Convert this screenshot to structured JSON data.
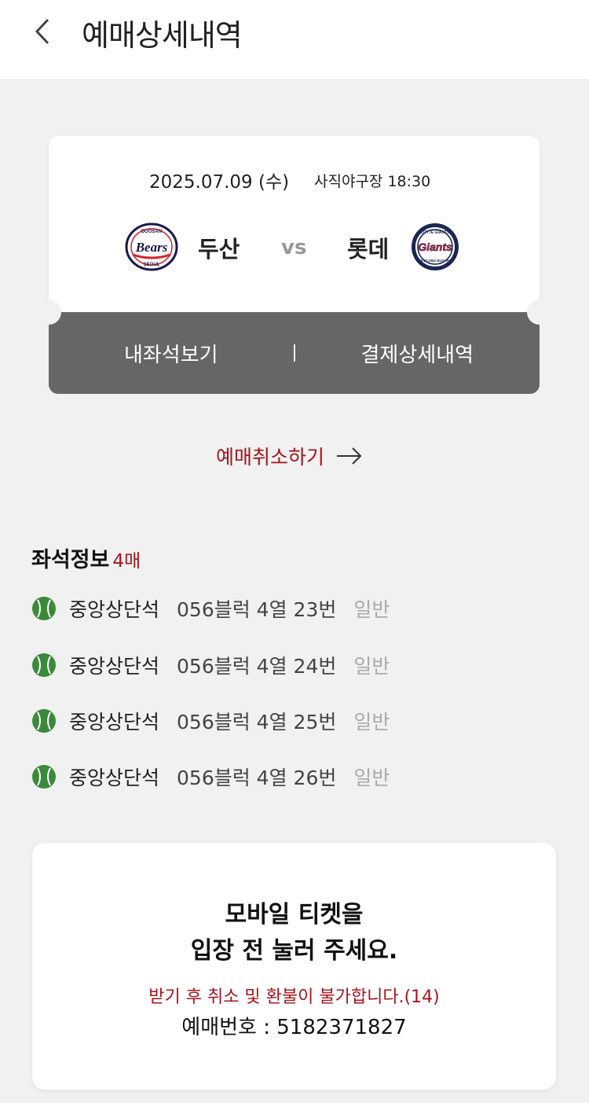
{
  "header": {
    "title": "예매상세내역",
    "back_icon": "chevron-left-icon"
  },
  "ticket": {
    "date": "2025.07.09 (수)",
    "venue_time": "사직야구장 18:30",
    "away_team": {
      "name": "두산",
      "logo_text": "Bears",
      "logo_top": "DOOSAN",
      "logo_bottom": "SEOUL",
      "color": "#1a1748"
    },
    "vs": "vs",
    "home_team": {
      "name": "롯데",
      "logo_text": "Giants",
      "logo_top": "LOTTE GIANTS",
      "logo_bottom": "EST.1982 BUSAN",
      "color": "#d41f2c"
    },
    "my_seat_link": "내좌석보기",
    "divider": "|",
    "payment_link": "결제상세내역"
  },
  "cancel": {
    "label": "예매취소하기",
    "arrow_icon": "arrow-right-icon"
  },
  "seats": {
    "title": "좌석정보",
    "count": "4매",
    "items": [
      {
        "zone": "중앙상단석",
        "detail": "056블럭 4열 23번",
        "type": "일반"
      },
      {
        "zone": "중앙상단석",
        "detail": "056블럭 4열 24번",
        "type": "일반"
      },
      {
        "zone": "중앙상단석",
        "detail": "056블럭 4열 25번",
        "type": "일반"
      },
      {
        "zone": "중앙상단석",
        "detail": "056블럭 4열 26번",
        "type": "일반"
      }
    ]
  },
  "mobile_ticket": {
    "line1": "모바일 티켓을",
    "line2": "입장 전 눌러 주세요.",
    "warning": "받기 후 취소 및 환불이 불가합니다.(14)",
    "booking_number": "예매번호 : 5182371827"
  },
  "colors": {
    "accent": "#a8141c",
    "ball": "#3b8a3a",
    "ticket_bar": "#666666"
  }
}
